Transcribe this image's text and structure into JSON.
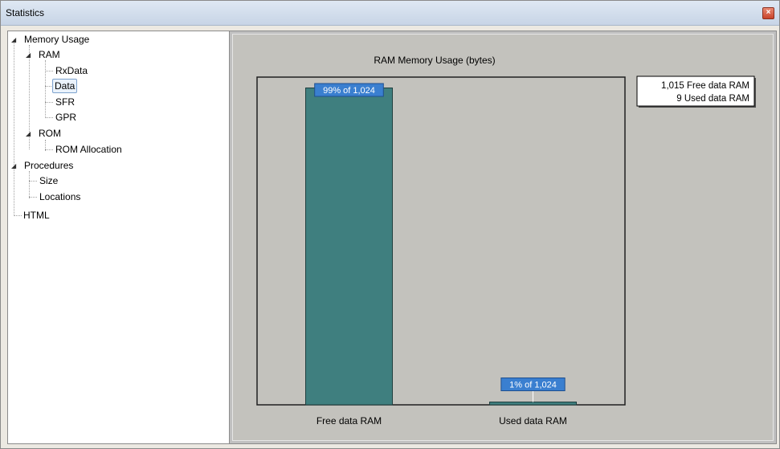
{
  "window": {
    "title": "Statistics"
  },
  "tree": {
    "memory_usage": "Memory Usage",
    "ram": "RAM",
    "rxdata": "RxData",
    "data": "Data",
    "sfr": "SFR",
    "gpr": "GPR",
    "rom": "ROM",
    "rom_allocation": "ROM Allocation",
    "procedures": "Procedures",
    "size": "Size",
    "locations": "Locations",
    "html": "HTML",
    "selected": "Data"
  },
  "chart_data": {
    "type": "bar",
    "title": "RAM Memory Usage (bytes)",
    "categories": [
      "Free data RAM",
      "Used data RAM"
    ],
    "values": [
      1015,
      9
    ],
    "total": 1024,
    "data_labels": [
      "99% of 1,024",
      "1% of 1,024"
    ],
    "legend": [
      "1,015 Free data RAM",
      "9 Used data RAM"
    ],
    "legend_position": "top-right",
    "grid": false,
    "ylim": [
      0,
      1024
    ],
    "bar_color": "#3f7f7f",
    "label_color": "#3a7fd0"
  }
}
